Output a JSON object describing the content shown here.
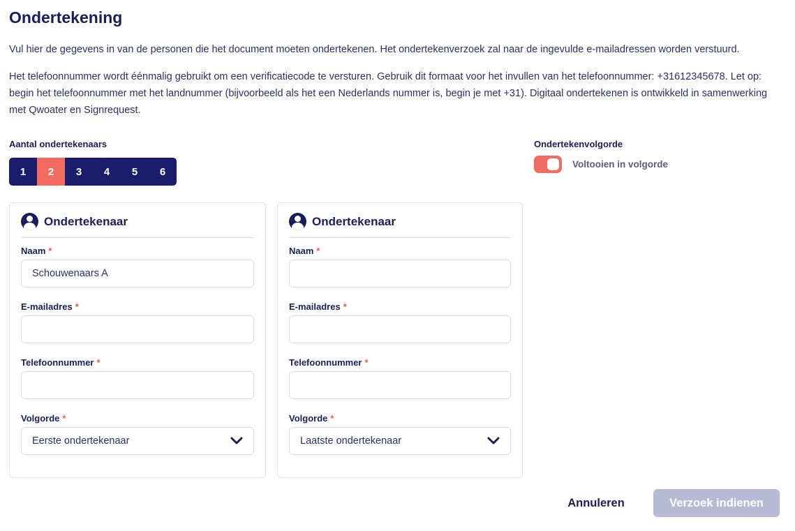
{
  "page": {
    "title": "Ondertekening",
    "intro": "Vul hier de gegevens in van de personen die het document moeten ondertekenen. Het ondertekenverzoek zal naar de ingevulde e-mailadressen worden verstuurd.",
    "phone_info": "Het telefoonnummer wordt éénmalig gebruikt om een verificatiecode te versturen. Gebruik dit formaat voor het invullen van het telefoonnummer: +31612345678. Let op: begin het telefoonnummer met het landnummer (bijvoorbeeld als het een Nederlands nummer is, begin je met +31). Digitaal ondertekenen is ontwikkeld in samenwerking met Qwoater en Signrequest."
  },
  "signer_count": {
    "label": "Aantal ondertekenaars",
    "options": [
      "1",
      "2",
      "3",
      "4",
      "5",
      "6"
    ],
    "selected": "2"
  },
  "signing_order": {
    "label": "Ondertekenvolgorde",
    "toggle_label": "Voltooien in volgorde",
    "enabled": true
  },
  "signers": [
    {
      "heading": "Ondertekenaar",
      "name_label": "Naam",
      "name_value": "Schouwenaars A",
      "email_label": "E-mailadres",
      "email_value": "",
      "phone_label": "Telefoonnummer",
      "phone_value": "",
      "order_label": "Volgorde",
      "order_value": "Eerste ondertekenaar"
    },
    {
      "heading": "Ondertekenaar",
      "name_label": "Naam",
      "name_value": "",
      "email_label": "E-mailadres",
      "email_value": "",
      "phone_label": "Telefoonnummer",
      "phone_value": "",
      "order_label": "Volgorde",
      "order_value": "Laatste ondertekenaar"
    }
  ],
  "required_marker": "*",
  "actions": {
    "cancel_label": "Annuleren",
    "submit_label": "Verzoek indienen"
  },
  "colors": {
    "primary": "#1a1d6b",
    "accent": "#f26b61",
    "disabled": "#b8b9d4"
  }
}
